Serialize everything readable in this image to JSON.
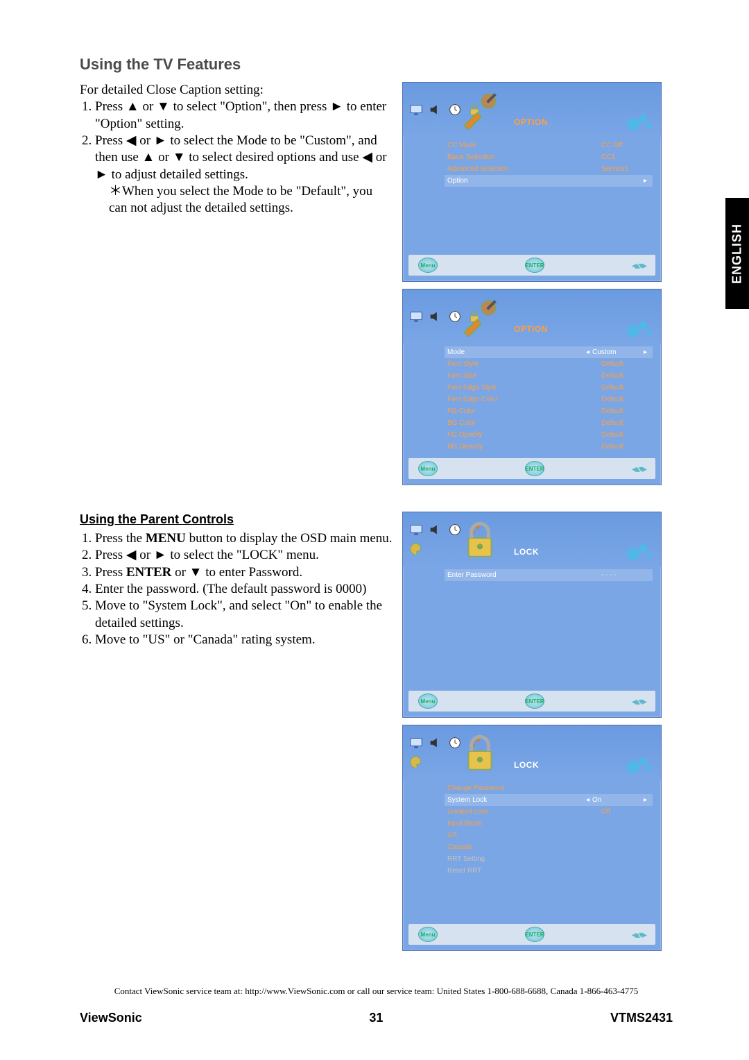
{
  "lang_tab": "ENGLISH",
  "section_title": "Using the TV Features",
  "intro": "For detailed Close Caption setting:",
  "arrows": {
    "up": "▲",
    "down": "▼",
    "left": "◀",
    "right": "►"
  },
  "steps1": {
    "s1_a": "Press ",
    "s1_b": " or ",
    "s1_c": " to select \"Option\", then press ",
    "s1_d": " to enter \"Option\" setting.",
    "s2_a": "Press ",
    "s2_b": " or ",
    "s2_c": " to select the Mode to be \"Custom\", and then use ",
    "s2_d": " or ",
    "s2_e": " to select desired options and use ",
    "s2_f": " or ",
    "s2_g": " to adjust detailed settings.",
    "note": "＊When you select the Mode to be \"Default\", you can not adjust the detailed settings."
  },
  "sub_title": "Using the Parent Controls",
  "steps2": {
    "s1_a": "Press the ",
    "s1_b": "MENU",
    "s1_c": " button to display the OSD main menu.",
    "s2_a": "Press ",
    "s2_b": " or ",
    "s2_c": " to select the \"LOCK\" menu.",
    "s3_a": "Press ",
    "s3_b": "ENTER",
    "s3_c": " or ",
    "s3_d": " to enter Password.",
    "s4": "Enter the password. (The default password is 0000)",
    "s5": "Move to \"System Lock\", and select \"On\" to enable the detailed settings.",
    "s6": "Move to \"US\" or \"Canada\" rating system."
  },
  "osd1": {
    "title": "OPTION",
    "rows": [
      {
        "lab": "CC Mode",
        "val": "CC Off"
      },
      {
        "lab": "Basic Selection",
        "val": "CC1"
      },
      {
        "lab": "Advanced Selection",
        "val": "Service1"
      },
      {
        "lab": "Option",
        "val": "",
        "sel": true,
        "arrows": true
      }
    ],
    "foot_left": "Menu",
    "foot_mid": "ENTER"
  },
  "osd2": {
    "title": "OPTION",
    "rows": [
      {
        "lab": "Mode",
        "val": "Custom",
        "sel": true,
        "arrows": true
      },
      {
        "lab": "Font Style",
        "val": "Default"
      },
      {
        "lab": "Font Size",
        "val": "Default"
      },
      {
        "lab": "Font Edge Style",
        "val": "Default"
      },
      {
        "lab": "Font Edge Color",
        "val": "Default"
      },
      {
        "lab": "FG Color",
        "val": "Default"
      },
      {
        "lab": "BG Color",
        "val": "Default"
      },
      {
        "lab": "FG Opacity",
        "val": "Default"
      },
      {
        "lab": "BG Opacity",
        "val": "Default"
      }
    ],
    "foot_left": "Menu",
    "foot_mid": "ENTER"
  },
  "osd3": {
    "title": "LOCK",
    "rows": [
      {
        "lab": "Enter Password",
        "val": "- - - -",
        "sel": true
      }
    ],
    "foot_left": "Menu",
    "foot_mid": "ENTER"
  },
  "osd4": {
    "title": "LOCK",
    "rows": [
      {
        "lab": "Change Password",
        "val": ""
      },
      {
        "lab": "System Lock",
        "val": "On",
        "sel": true,
        "arrows": true
      },
      {
        "lab": "Unrated Lock",
        "val": "Off"
      },
      {
        "lab": "Input Block",
        "val": ""
      },
      {
        "lab": "US",
        "val": ""
      },
      {
        "lab": "Canada",
        "val": ""
      },
      {
        "lab": "RRT Setting",
        "val": "",
        "muted": true
      },
      {
        "lab": "Reset RRT",
        "val": "",
        "muted": true
      }
    ],
    "foot_left": "Menu",
    "foot_mid": "ENTER"
  },
  "footer_note": "Contact ViewSonic service team at: http://www.ViewSonic.com or call our service team: United States 1-800-688-6688, Canada 1-866-463-4775",
  "brand": "ViewSonic",
  "page_num": "31",
  "model": "VTMS2431"
}
